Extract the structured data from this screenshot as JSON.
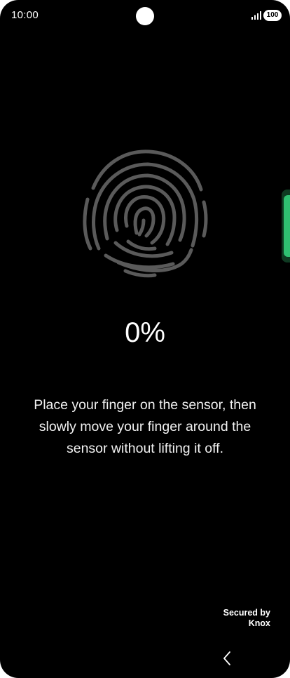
{
  "status_bar": {
    "time": "10:00",
    "battery": "100",
    "icons": [
      "camera-cutout",
      "signal-icon",
      "battery-icon"
    ]
  },
  "enrollment": {
    "progress": "0%",
    "progress_value": 0,
    "instruction_lines": [
      "Place your finger on the sensor, then",
      "slowly move your finger around the",
      "sensor without lifting it off."
    ]
  },
  "footer": {
    "secured_by": "Secured by",
    "knox": "Knox"
  },
  "navigation": {
    "back_icon": "chevron-left-icon"
  },
  "colors": {
    "background": "#000000",
    "fingerprint_stroke": "#5a5a5a",
    "text": "#ffffff",
    "edge_panel_accent": "#2fbf71"
  }
}
